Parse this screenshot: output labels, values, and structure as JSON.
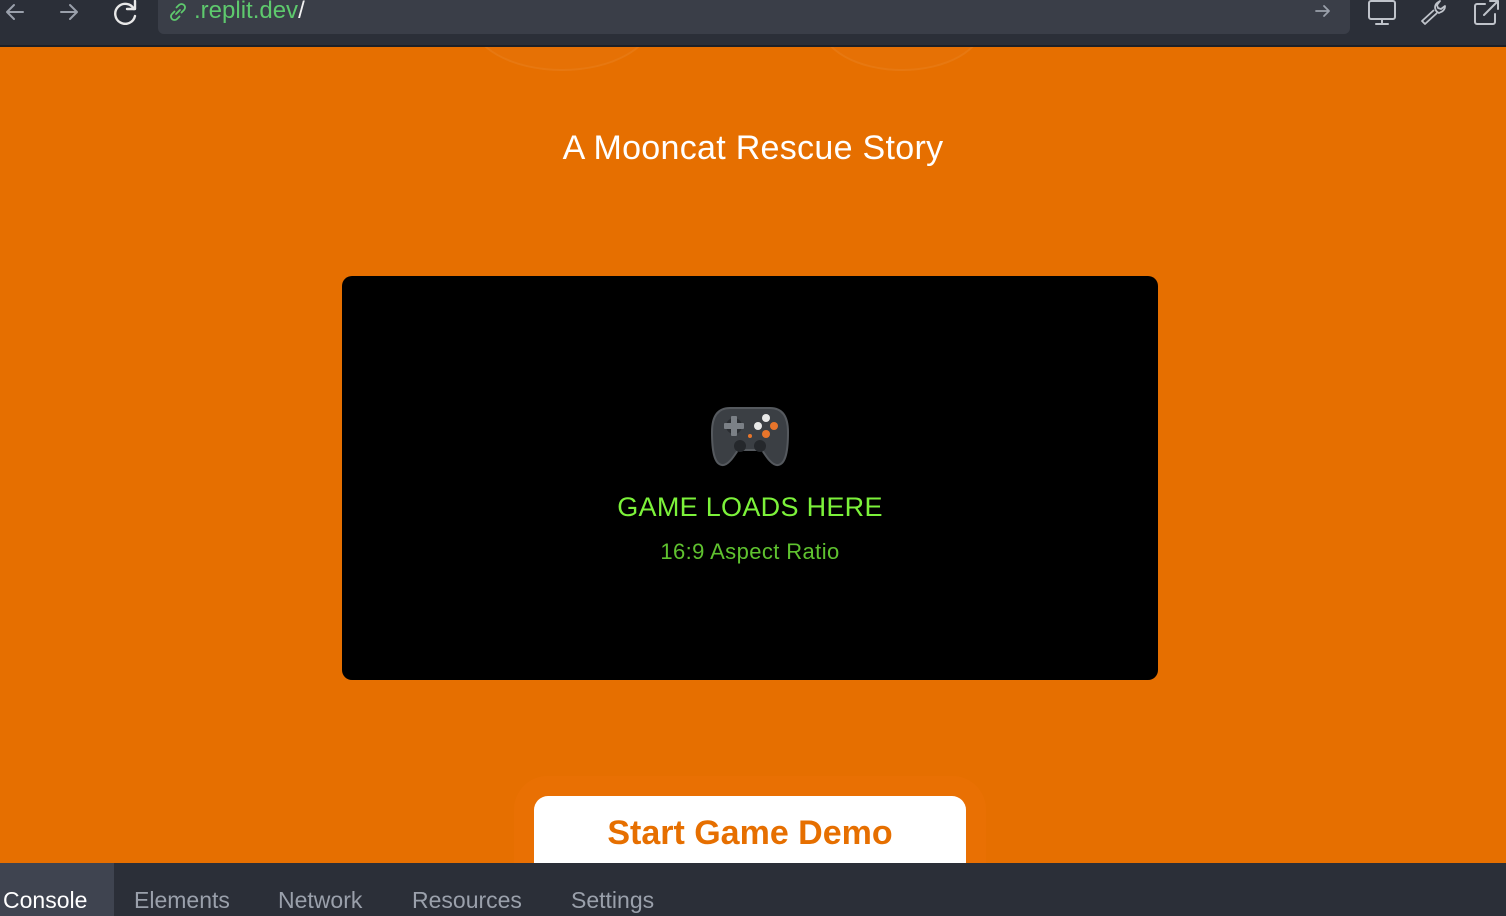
{
  "browser": {
    "url_domain": ".replit.dev",
    "url_path": "/"
  },
  "page": {
    "title": "A Mooncat Rescue Story",
    "game_placeholder": {
      "icon": "game-controller-icon",
      "label": "GAME LOADS HERE",
      "sublabel": "16:9 Aspect Ratio"
    },
    "start_button_label": "Start Game Demo"
  },
  "devtools": {
    "tabs": [
      "Console",
      "Elements",
      "Network",
      "Resources",
      "Settings"
    ],
    "active_tab": "Console"
  },
  "colors": {
    "page_background": "#e66f00",
    "browser_chrome": "#2b2f38",
    "url_green": "#5ec96d",
    "game_label_green": "#7cf23a",
    "game_sublabel_green": "#5fc22f",
    "button_text": "#e66f00"
  }
}
